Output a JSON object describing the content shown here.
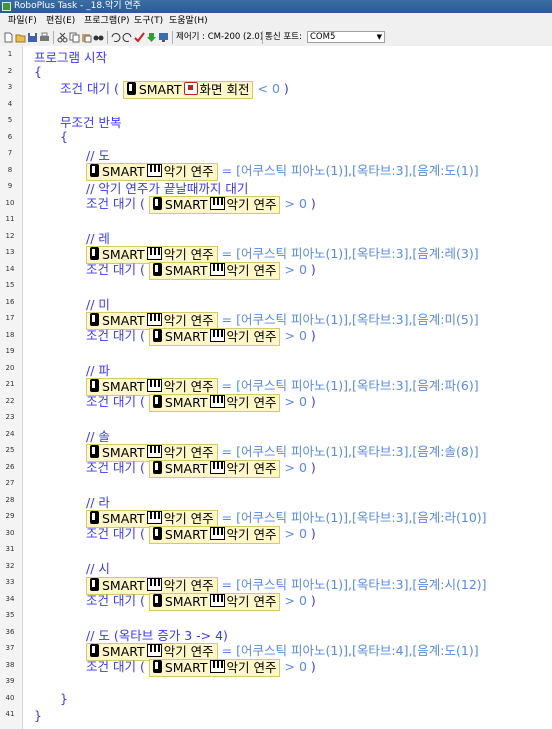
{
  "window": {
    "title": "RoboPlus Task - _18.악기 연주"
  },
  "menu": [
    "파일(F)",
    "편집(E)",
    "프로그램(P)",
    "도구(T)",
    "도움말(H)"
  ],
  "toolbar": {
    "controller": "제어기 : CM-200 (2.0)",
    "port_label": "통신 포트:",
    "port_value": "COM5"
  },
  "code": {
    "line_numbers": [
      "1",
      "2",
      "3",
      "4",
      "5",
      "6",
      "7",
      "8",
      "9",
      "10",
      "11",
      "12",
      "13",
      "14",
      "15",
      "16",
      "17",
      "18",
      "19",
      "20",
      "21",
      "22",
      "23",
      "24",
      "25",
      "26",
      "27",
      "28",
      "29",
      "30",
      "31",
      "32",
      "33",
      "34",
      "35",
      "36",
      "37",
      "38",
      "39",
      "40",
      "41"
    ],
    "program_start": "프로그램 시작",
    "open_brace": "{",
    "close_brace": "}",
    "wait_kw": "조건 대기 (",
    "loop_kw": "무조건 반복",
    "smart": "SMART",
    "rotate_label": "화면 회전",
    "play_label": "악기 연주",
    "lt": "<",
    "gt": ">",
    "eq": "=",
    "zero": "0",
    "close_paren": ")",
    "comment_wait": "// 악기 연주가 끝날때까지 대기",
    "notes": [
      {
        "comment": "// 도",
        "value": "[어쿠스틱  피아노(1)],[옥타브:3],[음계:도(1)]"
      },
      {
        "comment": "// 레",
        "value": "[어쿠스틱  피아노(1)],[옥타브:3],[음계:레(3)]"
      },
      {
        "comment": "// 미",
        "value": "[어쿠스틱  피아노(1)],[옥타브:3],[음계:미(5)]"
      },
      {
        "comment": "// 파",
        "value": "[어쿠스틱  피아노(1)],[옥타브:3],[음계:파(6)]"
      },
      {
        "comment": "// 솔",
        "value": "[어쿠스틱  피아노(1)],[옥타브:3],[음계:솔(8)]"
      },
      {
        "comment": "// 라",
        "value": "[어쿠스틱  피아노(1)],[옥타브:3],[음계:라(10)]"
      },
      {
        "comment": "// 시",
        "value": "[어쿠스틱  피아노(1)],[옥타브:3],[음계:시(12)]"
      },
      {
        "comment": "// 도 (옥타브 증가 3 -> 4)",
        "value": "[어쿠스틱  피아노(1)],[옥타브:4],[음계:도(1)]"
      }
    ]
  }
}
